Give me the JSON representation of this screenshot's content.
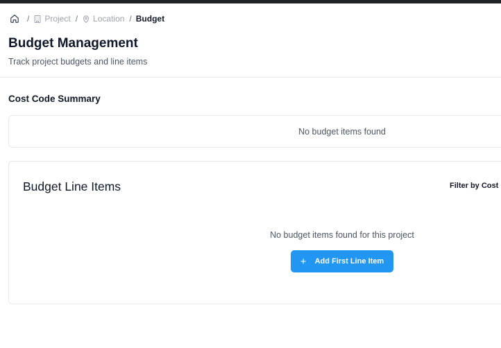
{
  "breadcrumb": {
    "home_icon": "home-icon",
    "items": [
      {
        "label": "Project",
        "icon": "building-icon"
      },
      {
        "label": "Location",
        "icon": "map-pin-icon"
      },
      {
        "label": "Budget"
      }
    ],
    "separator": "/"
  },
  "header": {
    "title": "Budget Management",
    "subtitle": "Track project budgets and line items"
  },
  "cost_code_summary": {
    "title": "Cost Code Summary",
    "empty_text": "No budget items found"
  },
  "line_items": {
    "title": "Budget Line Items",
    "filter_label": "Filter by Cost Code",
    "empty_text": "No budget items found for this project",
    "add_button": {
      "label": "Add First Line Item",
      "icon": "plus-icon"
    }
  },
  "colors": {
    "primary": "#2196f3",
    "topbar": "#1f2328",
    "border": "#e5e7eb"
  }
}
